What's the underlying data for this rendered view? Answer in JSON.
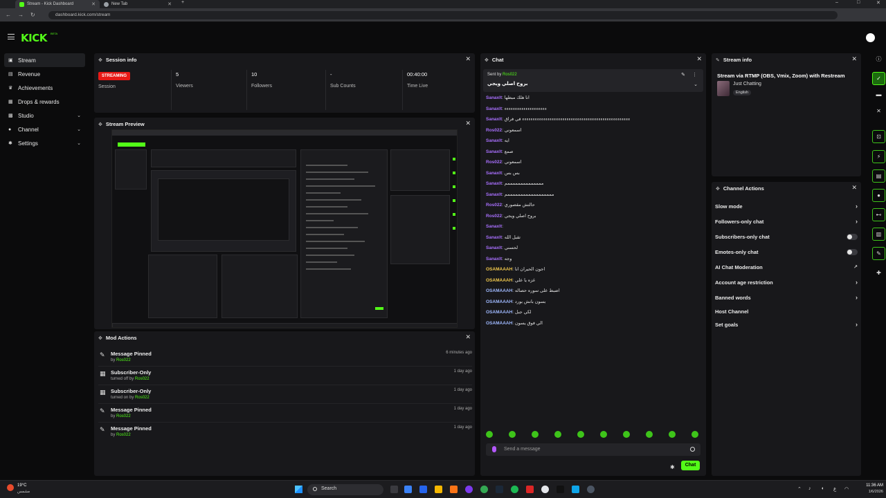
{
  "browser": {
    "tabs": [
      {
        "title": "Stream - Kick Dashboard"
      },
      {
        "title": "New Tab"
      }
    ],
    "url": "dashboard.kick.com/stream"
  },
  "app": {
    "logo": "KICK",
    "logo_badge": "BETA"
  },
  "sidebar": {
    "items": [
      {
        "label": "Stream",
        "icon": "video-icon"
      },
      {
        "label": "Revenue",
        "icon": "dollar-icon"
      },
      {
        "label": "Achievements",
        "icon": "trophy-icon"
      },
      {
        "label": "Drops & rewards",
        "icon": "gift-icon"
      },
      {
        "label": "Studio",
        "icon": "studio-icon"
      },
      {
        "label": "Channel",
        "icon": "user-icon"
      },
      {
        "label": "Settings",
        "icon": "gear-icon"
      }
    ]
  },
  "session": {
    "title": "Session info",
    "status": "STREAMING",
    "status_label": "Session",
    "viewers_value": "5",
    "viewers_label": "Viewers",
    "followers_value": "10",
    "followers_label": "Followers",
    "subs_value": "-",
    "subs_label": "Sub Counts",
    "time_value": "00:40:00",
    "time_label": "Time Live"
  },
  "preview": {
    "title": "Stream Preview"
  },
  "mod": {
    "title": "Mod Actions",
    "rows": [
      {
        "title": "Message Pinned",
        "sub_prefix": "by",
        "user": "Ros022",
        "time": "6 minutes ago",
        "icon": "pin-icon"
      },
      {
        "title": "Subscriber-Only",
        "sub_prefix": "turned off by",
        "user": "Ros022",
        "time": "1 day ago",
        "icon": "gift-icon"
      },
      {
        "title": "Subscriber-Only",
        "sub_prefix": "turned on by",
        "user": "Ros022",
        "time": "1 day ago",
        "icon": "gift-icon"
      },
      {
        "title": "Message Pinned",
        "sub_prefix": "by",
        "user": "Ros022",
        "time": "1 day ago",
        "icon": "pin-icon"
      },
      {
        "title": "Message Pinned",
        "sub_prefix": "by",
        "user": "Ros022",
        "time": "1 day ago",
        "icon": "pin-icon"
      }
    ]
  },
  "chat": {
    "title": "Chat",
    "pinned_by_label": "Sent by",
    "pinned_user": "Ros022",
    "pinned_text": "بروح اصلي ويجي",
    "messages": [
      {
        "user": "Sanaxlt",
        "text": "انا هلك مبطها ",
        "color": "#a970ff"
      },
      {
        "user": "Sanaxlt",
        "text": "ءءءءءءءءءءءءءءءءءءءء",
        "color": "#a970ff"
      },
      {
        "user": "Sanaxlt",
        "text": "ءءءءءءءءءءءءءءءءءءءءءءءءءءءءءءءءءءءءءءءءءءءءءءءءءءء في فراق",
        "color": "#a970ff"
      },
      {
        "user": "Ros022",
        "text": "اسمعوني",
        "color": "#a970ff"
      },
      {
        "user": "Sanaxlt",
        "text": "ايه",
        "color": "#a970ff"
      },
      {
        "user": "Sanaxlt",
        "text": "صمع",
        "color": "#a970ff"
      },
      {
        "user": "Ros022",
        "text": "اسمعوني",
        "color": "#a970ff"
      },
      {
        "user": "Sanaxlt",
        "text": "بس بس",
        "color": "#a970ff"
      },
      {
        "user": "Sanaxlt",
        "text": "ممممممممممممممم",
        "color": "#a970ff"
      },
      {
        "user": "Sanaxlt",
        "text": "ممممممممممممممممممم",
        "color": "#a970ff"
      },
      {
        "user": "Ros022",
        "text": "حالتش مقصوري",
        "color": "#a970ff"
      },
      {
        "user": "Ros022",
        "text": "بروح اصلي ويجي",
        "color": "#a970ff"
      },
      {
        "user": "Sanaxlt",
        "text": "",
        "color": "#a970ff"
      },
      {
        "user": "Sanaxlt",
        "text": "تقبل الله",
        "color": "#a970ff"
      },
      {
        "user": "Sanaxlt",
        "text": "لحسني",
        "color": "#a970ff"
      },
      {
        "user": "Sanaxlt",
        "text": "وجه",
        "color": "#a970ff"
      },
      {
        "user": "OSAMAAAH",
        "text": "اجون الحيران انا",
        "color": "#f2c94c"
      },
      {
        "user": "OSAMAAAH",
        "text": "غزه يا علي",
        "color": "#f2c94c"
      },
      {
        "user": "OSAMAAAH",
        "text": "اضبط على سوره حصاله",
        "color": "#9fb9ff"
      },
      {
        "user": "OSAMAAAH",
        "text": "بسون بانش بورد",
        "color": "#9fb9ff"
      },
      {
        "user": "OSAMAAAH",
        "text": "لكي جبل",
        "color": "#9fb9ff"
      },
      {
        "user": "OSAMAAAH",
        "text": "الي فوق يسون",
        "color": "#9fb9ff"
      }
    ],
    "input_placeholder": "Send a message",
    "send_label": "Chat"
  },
  "stream_info": {
    "title": "Stream info",
    "stream_title": "Stream via RTMP (OBS, Vmix, Zoom) with Restream",
    "category": "Just Chatting",
    "language_tag": "English"
  },
  "channel_actions": {
    "title": "Channel Actions",
    "items": [
      {
        "label": "Slow mode",
        "control": "arrow"
      },
      {
        "label": "Followers-only chat",
        "control": "arrow"
      },
      {
        "label": "Subscribers-only chat",
        "control": "toggle"
      },
      {
        "label": "Emotes-only chat",
        "control": "toggle"
      },
      {
        "label": "AI Chat Moderation",
        "control": "external"
      },
      {
        "label": "Account age restriction",
        "control": "arrow"
      },
      {
        "label": "Banned words",
        "control": "arrow"
      },
      {
        "label": "Host Channel",
        "control": "none"
      },
      {
        "label": "Set goals",
        "control": "arrow"
      }
    ]
  },
  "taskbar": {
    "temperature": "19°C",
    "weather": "مشمس",
    "search_label": "Search",
    "time": "11:36 AM",
    "date": "1/6/2026"
  },
  "colors": {
    "accent": "#53fc18",
    "live": "#e91916",
    "panel": "#18181b",
    "background": "#0b0b0c"
  }
}
